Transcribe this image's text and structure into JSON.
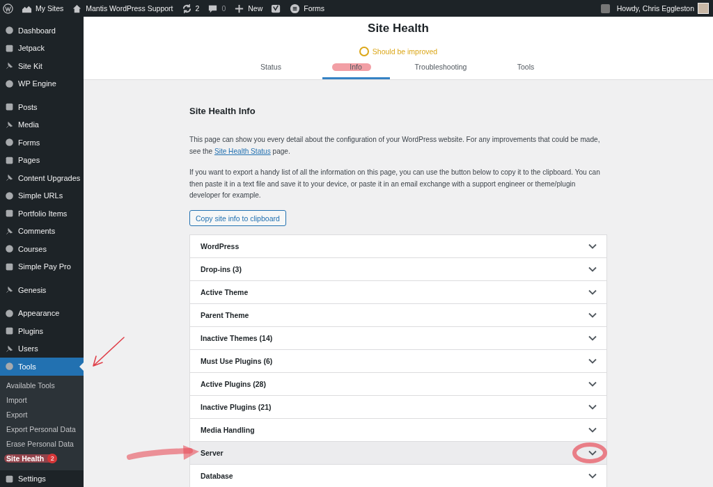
{
  "admin_bar": {
    "items": [
      {
        "kind": "wp-logo"
      },
      {
        "kind": "my-sites",
        "label": "My Sites"
      },
      {
        "kind": "home",
        "label": "Mantis WordPress Support"
      },
      {
        "kind": "updates",
        "label": "2"
      },
      {
        "kind": "comments",
        "label": "0"
      },
      {
        "kind": "new",
        "label": "New"
      },
      {
        "kind": "seo"
      },
      {
        "kind": "forms",
        "label": "Forms"
      }
    ],
    "account": {
      "greeting": "Howdy, Chris Eggleston"
    }
  },
  "sidebar": {
    "groups": [
      {
        "items": [
          {
            "label": "Dashboard",
            "selected": false
          },
          {
            "label": "Jetpack",
            "selected": false
          },
          {
            "label": "Site Kit",
            "selected": false
          },
          {
            "label": "WP Engine",
            "selected": false
          }
        ]
      },
      {
        "items": [
          {
            "label": "Posts",
            "selected": false
          },
          {
            "label": "Media",
            "selected": false
          },
          {
            "label": "Forms",
            "selected": false
          },
          {
            "label": "Pages",
            "selected": false
          },
          {
            "label": "Content Upgrades",
            "selected": false
          },
          {
            "label": "Simple URLs",
            "selected": false
          },
          {
            "label": "Portfolio Items",
            "selected": false
          },
          {
            "label": "Comments",
            "selected": false
          },
          {
            "label": "Courses",
            "selected": false
          },
          {
            "label": "Simple Pay Pro",
            "selected": false
          }
        ]
      },
      {
        "items": [
          {
            "label": "Genesis",
            "selected": false
          }
        ]
      },
      {
        "items": [
          {
            "label": "Appearance",
            "selected": false
          },
          {
            "label": "Plugins",
            "selected": false
          },
          {
            "label": "Users",
            "selected": false
          },
          {
            "label": "Tools",
            "selected": true,
            "arrow_mark": true,
            "submenu": [
              {
                "label": "Available Tools",
                "selected": false
              },
              {
                "label": "Import",
                "selected": false
              },
              {
                "label": "Export",
                "selected": false
              },
              {
                "label": "Export Personal Data",
                "selected": false
              },
              {
                "label": "Erase Personal Data",
                "selected": false
              },
              {
                "label": "Site Health",
                "selected": true,
                "badge": "2",
                "highlight_mark": true
              }
            ]
          },
          {
            "label": "Settings",
            "selected": false
          }
        ]
      }
    ]
  },
  "header": {
    "title": "Site Health",
    "status": {
      "kind": "warning",
      "label": "Should be improved"
    },
    "tabs": [
      {
        "label": "Status",
        "selected": false
      },
      {
        "label": "Info",
        "selected": true,
        "highlight_mark": true
      },
      {
        "label": "Troubleshooting",
        "selected": false
      },
      {
        "label": "Tools",
        "selected": false
      }
    ]
  },
  "content": {
    "heading": "Site Health Info",
    "intro": {
      "before": "This page can show you every detail about the configuration of your WordPress website. For any improvements that could be made, see the ",
      "link": "Site Health Status",
      "after": " page."
    },
    "export_text": "If you want to export a handy list of all the information on this page, you can use the button below to copy it to the clipboard. You can then paste it in a text file and save it to your device, or paste it in an email exchange with a support engineer or theme/plugin developer for example.",
    "copy_button": "Copy site info to clipboard",
    "sections": [
      {
        "title": "WordPress",
        "hovered": false
      },
      {
        "title": "Drop-ins (3)",
        "hovered": false
      },
      {
        "title": "Active Theme",
        "hovered": false
      },
      {
        "title": "Parent Theme",
        "hovered": false
      },
      {
        "title": "Inactive Themes (14)",
        "hovered": false
      },
      {
        "title": "Must Use Plugins (6)",
        "hovered": false
      },
      {
        "title": "Active Plugins (28)",
        "hovered": false
      },
      {
        "title": "Inactive Plugins (21)",
        "hovered": false
      },
      {
        "title": "Media Handling",
        "hovered": false
      },
      {
        "title": "Server",
        "hovered": true,
        "arrow_mark": true,
        "circle_mark": true
      },
      {
        "title": "Database",
        "hovered": false
      }
    ]
  }
}
